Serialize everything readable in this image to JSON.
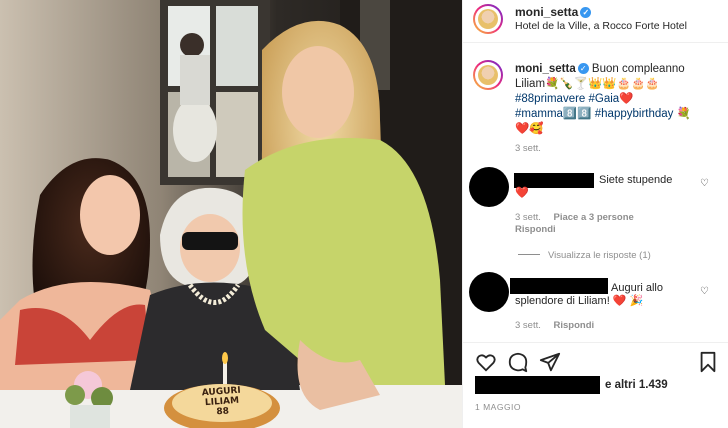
{
  "post": {
    "username": "moni_setta",
    "location": "Hotel de la Ville, a Rocco Forte Hotel",
    "caption_user": "moni_setta",
    "caption_line1": "Buon compleanno",
    "caption_line2": "Liliam💐🍾🍸👑👑🎂🎂🎂",
    "caption_line3_tags": "#88primavere #Gaia❤️",
    "caption_line4": "#mamma8️⃣8️⃣ #happybirthday 💐",
    "caption_line5": "❤️🥰",
    "caption_time": "3 sett."
  },
  "comments": [
    {
      "text": "Siete stupende",
      "emoji_line": "❤️",
      "time": "3 sett.",
      "likes": "Piace a 3 persone",
      "reply": "Rispondi",
      "view_replies": "Visualizza le risposte (1)"
    },
    {
      "text": "Auguri allo",
      "text_line2": "splendore di Liliam! ❤️ 🎉",
      "time": "3 sett.",
      "reply": "Rispondi"
    }
  ],
  "likes_text": "e altri 1.439",
  "date": "1 MAGGIO",
  "cake": {
    "line1": "AUGURI",
    "line2": "LILIAM",
    "line3": "88"
  }
}
